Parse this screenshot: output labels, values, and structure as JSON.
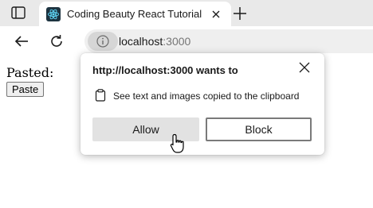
{
  "browser": {
    "tab": {
      "title": "Coding Beauty React Tutorial"
    },
    "address": {
      "host": "localhost",
      "port": ":3000"
    }
  },
  "page": {
    "pasted_label": "Pasted:",
    "paste_button": "Paste"
  },
  "permission_popup": {
    "title": "http://localhost:3000 wants to",
    "permission_text": "See text and images copied to the clipboard",
    "allow_label": "Allow",
    "block_label": "Block"
  }
}
